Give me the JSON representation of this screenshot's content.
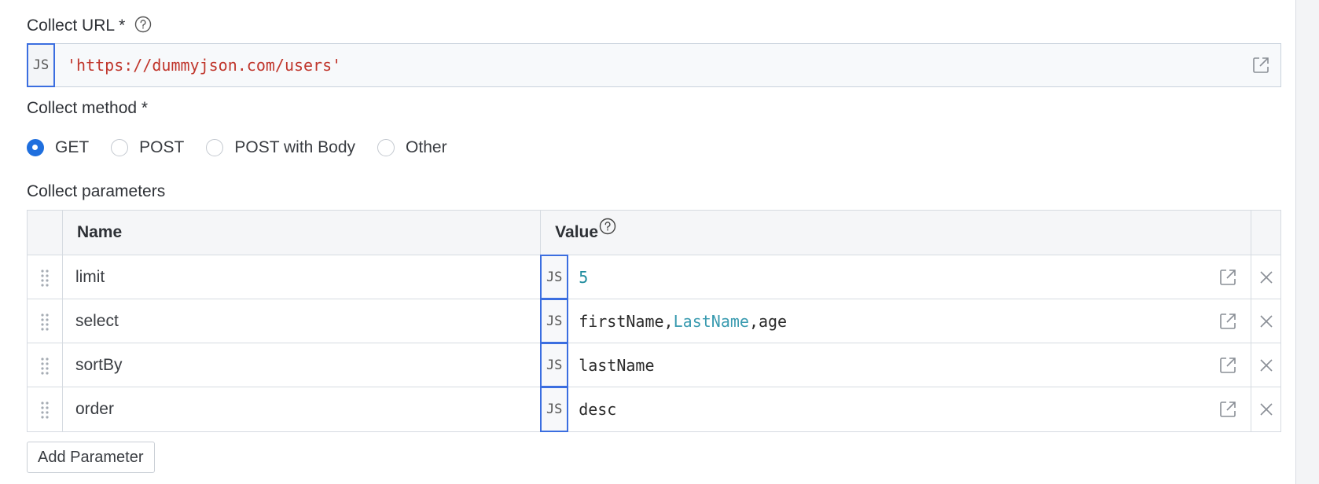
{
  "url_field": {
    "label": "Collect URL *",
    "js_badge": "JS",
    "value": "'https://dummyjson.com/users'"
  },
  "method": {
    "label": "Collect method *",
    "options": [
      "GET",
      "POST",
      "POST with Body",
      "Other"
    ],
    "selected": "GET"
  },
  "params": {
    "label": "Collect parameters",
    "columns": {
      "name": "Name",
      "value": "Value"
    },
    "rows": [
      {
        "name": "limit",
        "js_badge": "JS",
        "value": "5"
      },
      {
        "name": "select",
        "js_badge": "JS",
        "value": "firstName,LastName,age",
        "value_parts": [
          "firstName,",
          "LastName",
          ",age"
        ]
      },
      {
        "name": "sortBy",
        "js_badge": "JS",
        "value": "lastName"
      },
      {
        "name": "order",
        "js_badge": "JS",
        "value": "desc"
      }
    ],
    "add_button": "Add Parameter"
  },
  "colors": {
    "accent": "#1f6fde",
    "js_border": "#3b6ee0",
    "string_literal": "#c0362c",
    "number_literal": "#1f8c9e"
  }
}
